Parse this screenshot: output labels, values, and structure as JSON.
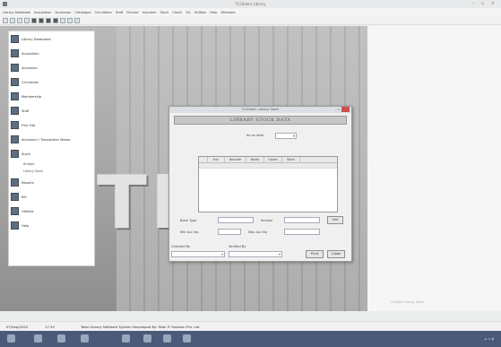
{
  "window": {
    "title": "TLSSdem Library"
  },
  "menu": [
    "Library Database",
    "Acquisition",
    "Accession",
    "Catalogue",
    "Circulation",
    "Staff",
    "Planner",
    "Inquiries",
    "Stock",
    "Check",
    "SIL",
    "Utilities",
    "Help",
    "Windows"
  ],
  "nav": {
    "items": [
      {
        "label": "Library Databases"
      },
      {
        "label": "Acquisition"
      },
      {
        "label": "Accession"
      },
      {
        "label": "Circulation"
      },
      {
        "label": "Membership"
      },
      {
        "label": "Staff"
      },
      {
        "label": "Fine Slot"
      },
      {
        "label": "Accession / Transaction Wiews"
      },
      {
        "label": "Stock"
      },
      {
        "label": "Reports"
      },
      {
        "label": "Bill"
      },
      {
        "label": "Utilities"
      },
      {
        "label": "Help"
      }
    ],
    "subitems": [
      "Budget",
      "Library Stock"
    ]
  },
  "dialog": {
    "title": "TLSSdem Library Stock",
    "header": "LIBRARY STOCK DATA",
    "as_on_label": "As on date",
    "as_on_value": "",
    "columns": [
      "Sno.",
      "Barcode",
      "Books",
      "Copies",
      "Stock"
    ],
    "fields": {
      "book_type_label": "Book Type",
      "section_label": "Section",
      "min_acc_label": "Min Acc No.",
      "max_acc_label": "Max Acc No",
      "checked_by_label": "Checked By",
      "verified_by_label": "Verified By"
    },
    "buttons": {
      "get": "Get",
      "print": "Print",
      "close": "Close"
    }
  },
  "status": {
    "date": "07/Sep/2022",
    "time": "17:25",
    "text": "Total Library Software System Developed By: Total IT Solution Pvt. Ltd."
  },
  "right_caption": "TLSSdem Library Stock",
  "colors": {
    "taskbar": "#4a5a78",
    "close_button": "#c9524b",
    "nav_icon": "#5d6f80"
  }
}
